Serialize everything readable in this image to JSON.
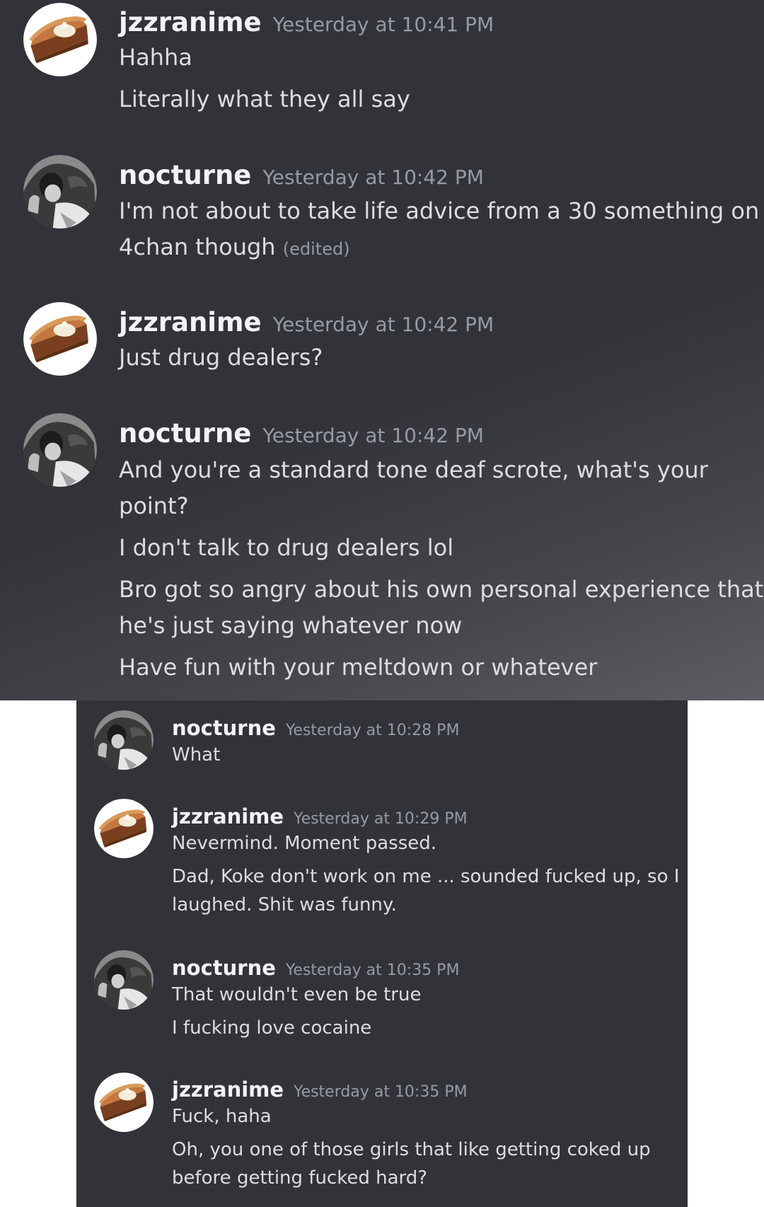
{
  "top_panel": {
    "messages": [
      {
        "username": "jzzranime",
        "timestamp": "Yesterday at 10:41 PM",
        "avatar": "pie-avatar-icon",
        "lines": [
          "Hahha",
          "Literally what they all say"
        ]
      },
      {
        "username": "nocturne",
        "timestamp": "Yesterday at 10:42 PM",
        "avatar": "bw-photo-avatar-icon",
        "lines": [
          "I'm not about to take life advice from a 30 something on",
          "4chan though"
        ],
        "edited": "(edited)"
      },
      {
        "username": "jzzranime",
        "timestamp": "Yesterday at 10:42 PM",
        "avatar": "pie-avatar-icon",
        "lines": [
          "Just drug dealers?"
        ]
      },
      {
        "username": "nocturne",
        "timestamp": "Yesterday at 10:42 PM",
        "avatar": "bw-photo-avatar-icon",
        "lines": [
          "And you're a standard tone deaf scrote, what's your",
          "point?",
          "I don't talk to drug dealers lol",
          "Bro got so angry about his own personal experience that",
          "he's just saying whatever now",
          "Have fun with your meltdown or whatever"
        ]
      }
    ]
  },
  "bottom_panel": {
    "messages": [
      {
        "username": "nocturne",
        "timestamp": "Yesterday at 10:28 PM",
        "avatar": "bw-photo-avatar-icon",
        "lines": [
          "What"
        ]
      },
      {
        "username": "jzzranime",
        "timestamp": "Yesterday at 10:29 PM",
        "avatar": "pie-avatar-icon",
        "lines": [
          "Nevermind. Moment passed.",
          "Dad, Koke don't work on me ... sounded fucked up, so I",
          "laughed. Shit was funny."
        ]
      },
      {
        "username": "nocturne",
        "timestamp": "Yesterday at 10:35 PM",
        "avatar": "bw-photo-avatar-icon",
        "lines": [
          "That wouldn't even be true",
          "I fucking love cocaine"
        ]
      },
      {
        "username": "jzzranime",
        "timestamp": "Yesterday at 10:35 PM",
        "avatar": "pie-avatar-icon",
        "lines": [
          "Fuck, haha",
          "Oh, you one of those girls that like getting coked up",
          "before getting fucked hard?"
        ]
      }
    ]
  },
  "colors": {
    "background": "#323339",
    "username": "#f2f3f5",
    "timestamp": "#949ba4",
    "message_text": "#dbdee1",
    "page": "#ffffff"
  }
}
